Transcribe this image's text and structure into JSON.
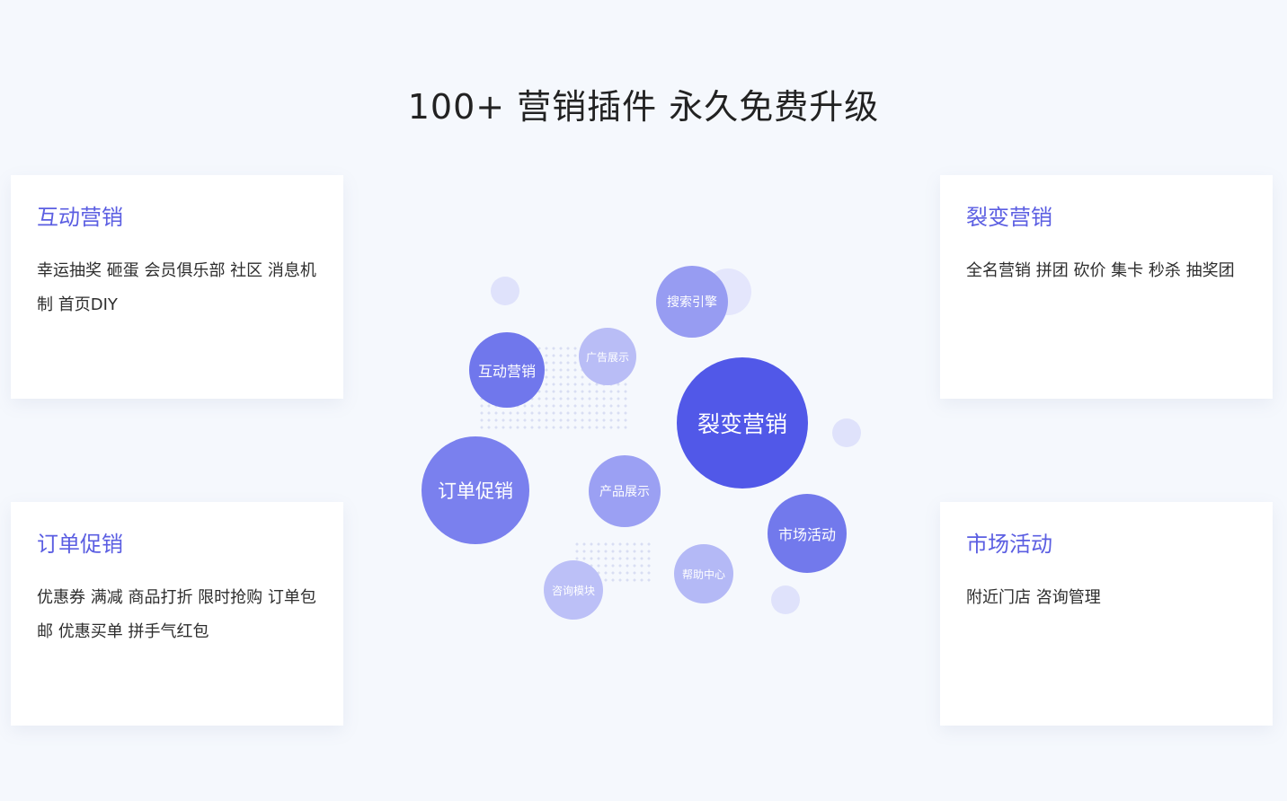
{
  "headline": "100+  营销插件 永久免费升级",
  "cards": {
    "interactive": {
      "title": "互动营销",
      "body": "幸运抽奖 砸蛋 会员俱乐部 社区 消息机制 首页DIY"
    },
    "fission": {
      "title": "裂变营销",
      "body": "全名营销 拼团 砍价 集卡 秒杀 抽奖团"
    },
    "order": {
      "title": "订单促销",
      "body": "优惠券 满减 商品打折 限时抢购 订单包邮 优惠买单 拼手气红包"
    },
    "market": {
      "title": "市场活动",
      "body": "附近门店 咨询管理"
    }
  },
  "bubbles": {
    "search": "搜索引擎",
    "ads": "广告展示",
    "interactive": "互动营销",
    "fission": "裂变营销",
    "order": "订单促销",
    "product": "产品展示",
    "market": "市场活动",
    "help": "帮助中心",
    "consult": "咨询模块"
  },
  "colors": {
    "accent": "#5b5ee2",
    "bubble_dark": "#5257e8",
    "bubble_mid": "#787fee",
    "bubble_light": "#9fa4f3",
    "bubble_pale": "#b7bcf6",
    "deco": "#dfe2fb"
  }
}
